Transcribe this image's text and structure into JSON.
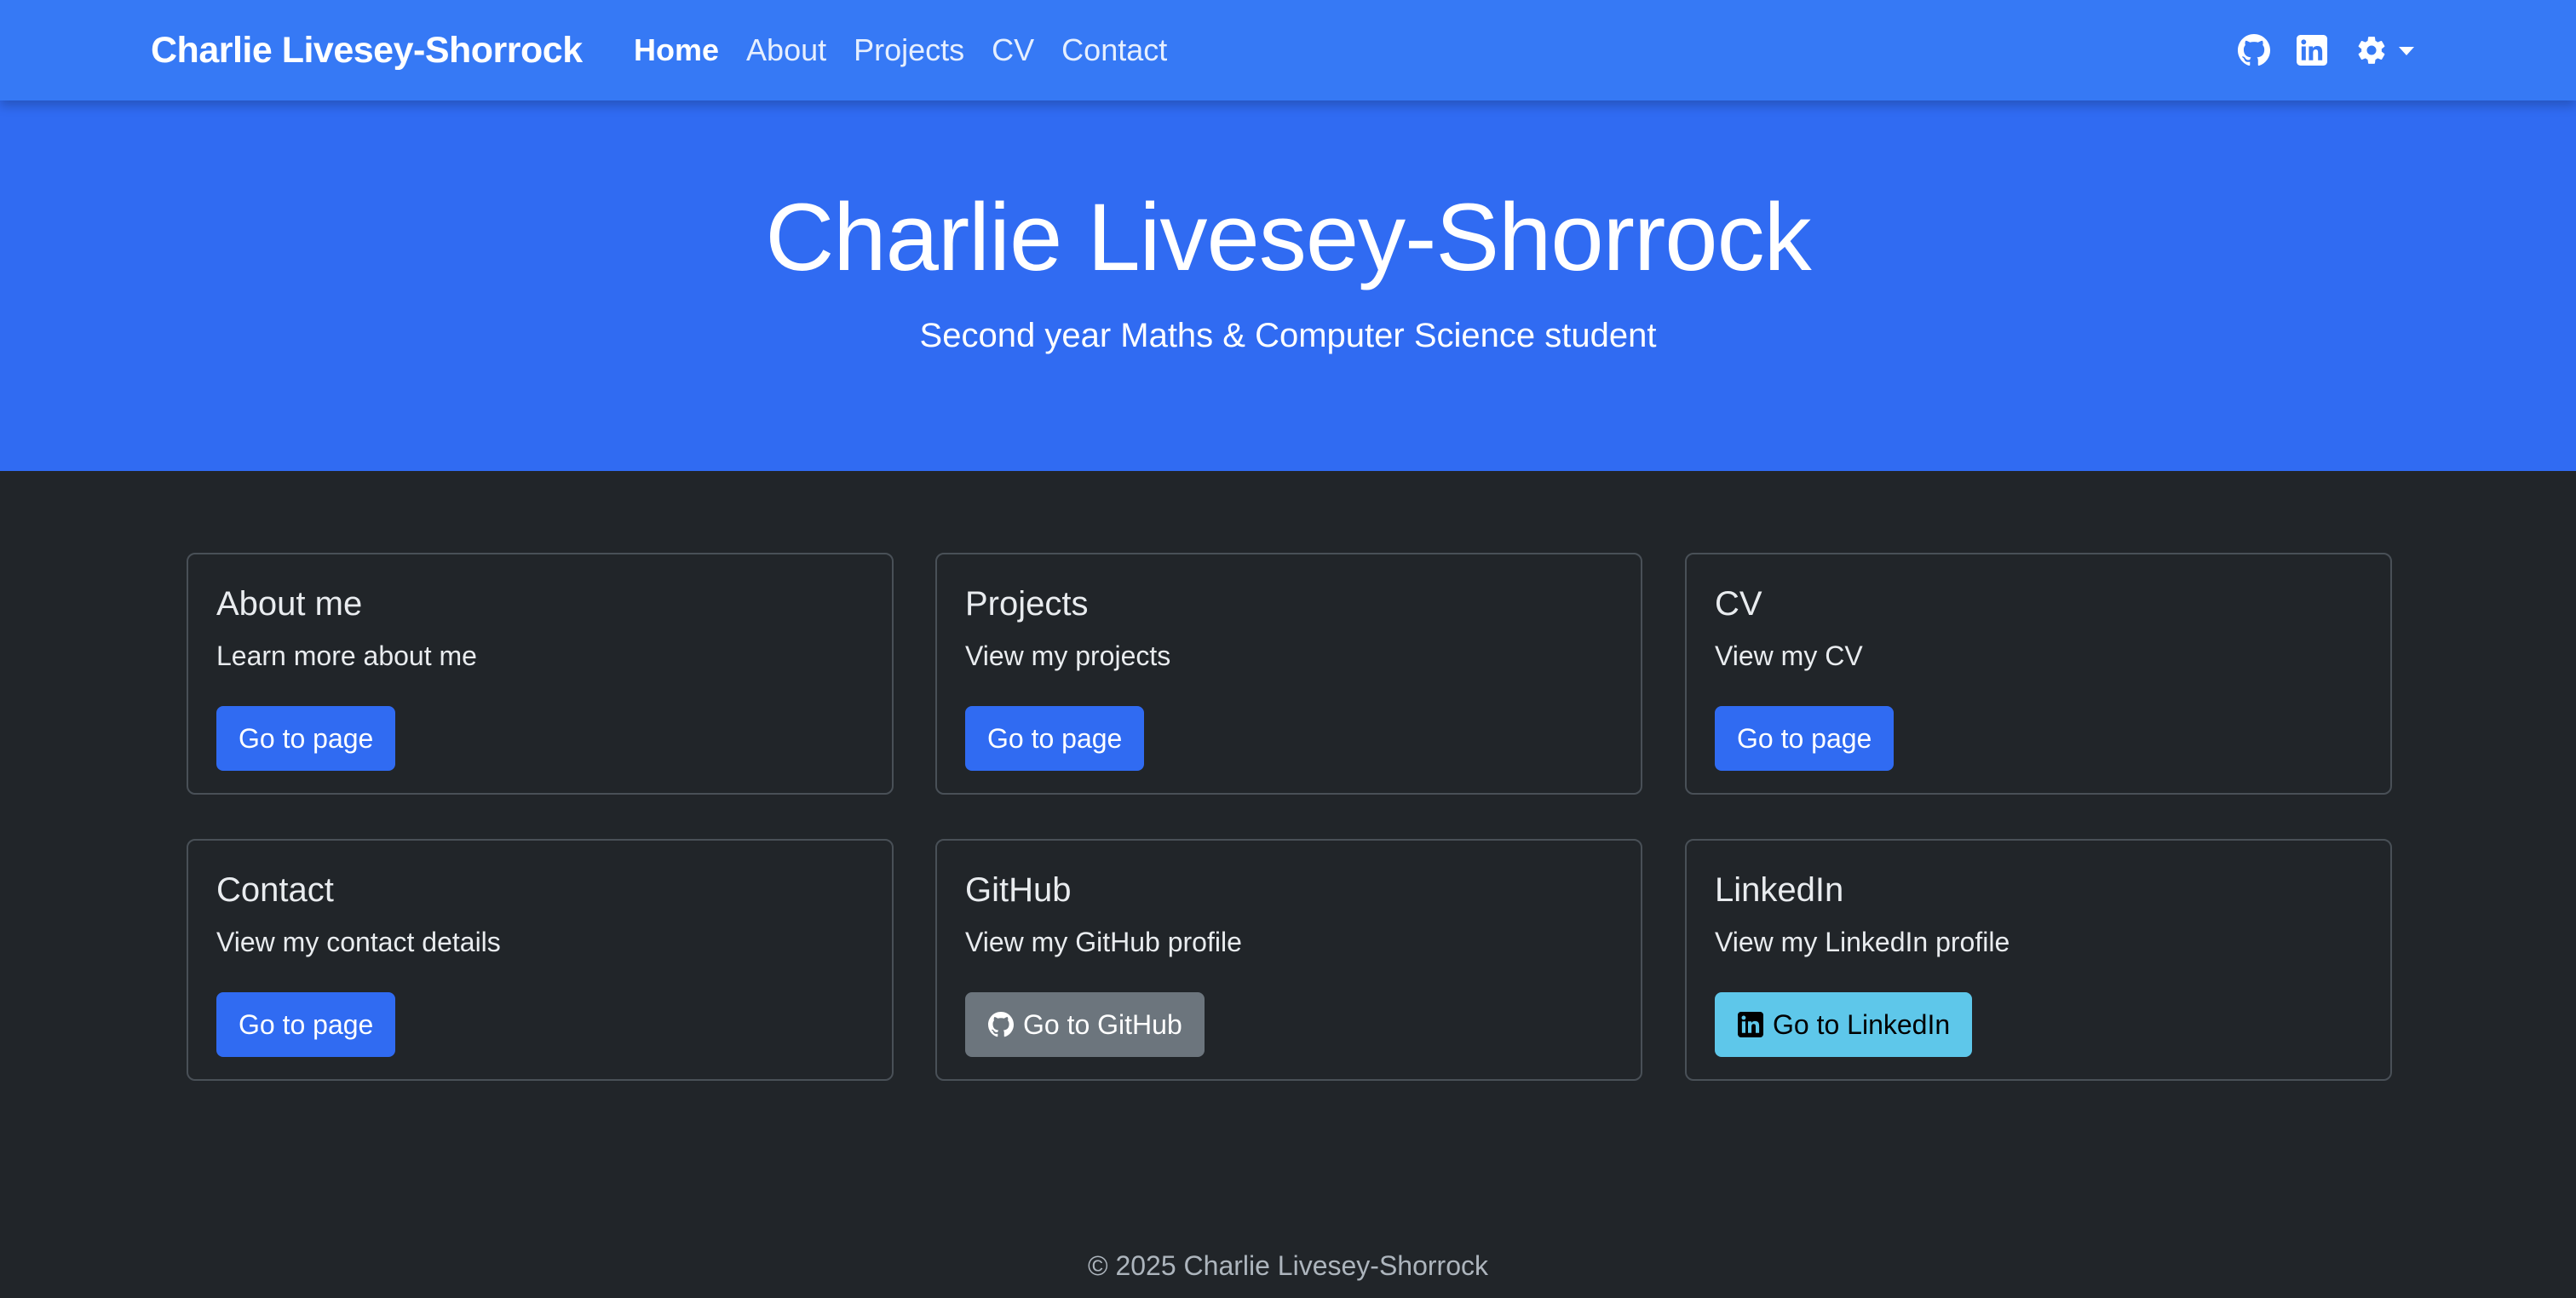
{
  "navbar": {
    "brand": "Charlie Livesey-Shorrock",
    "links": [
      {
        "label": "Home",
        "active": true
      },
      {
        "label": "About",
        "active": false
      },
      {
        "label": "Projects",
        "active": false
      },
      {
        "label": "CV",
        "active": false
      },
      {
        "label": "Contact",
        "active": false
      }
    ],
    "icons": [
      "github-icon",
      "linkedin-icon",
      "gear-icon",
      "caret-down-icon"
    ]
  },
  "hero": {
    "title": "Charlie Livesey-Shorrock",
    "subtitle": "Second year Maths & Computer Science student"
  },
  "cards": [
    {
      "title": "About me",
      "text": "Learn more about me",
      "button": "Go to page",
      "button_style": "primary"
    },
    {
      "title": "Projects",
      "text": "View my projects",
      "button": "Go to page",
      "button_style": "primary"
    },
    {
      "title": "CV",
      "text": "View my CV",
      "button": "Go to page",
      "button_style": "primary"
    },
    {
      "title": "Contact",
      "text": "View my contact details",
      "button": "Go to page",
      "button_style": "primary"
    },
    {
      "title": "GitHub",
      "text": "View my GitHub profile",
      "button": "Go to GitHub",
      "button_style": "secondary",
      "button_icon": "github-icon"
    },
    {
      "title": "LinkedIn",
      "text": "View my LinkedIn profile",
      "button": "Go to LinkedIn",
      "button_style": "info",
      "button_icon": "linkedin-icon"
    }
  ],
  "footer": {
    "copyright": "© 2025 Charlie Livesey-Shorrock"
  },
  "colors": {
    "navbar": "#3679f5",
    "hero": "#306bf2",
    "background": "#212529",
    "primary": "#306bf2",
    "secondary": "#6c757d",
    "info": "#5ec7ea"
  }
}
